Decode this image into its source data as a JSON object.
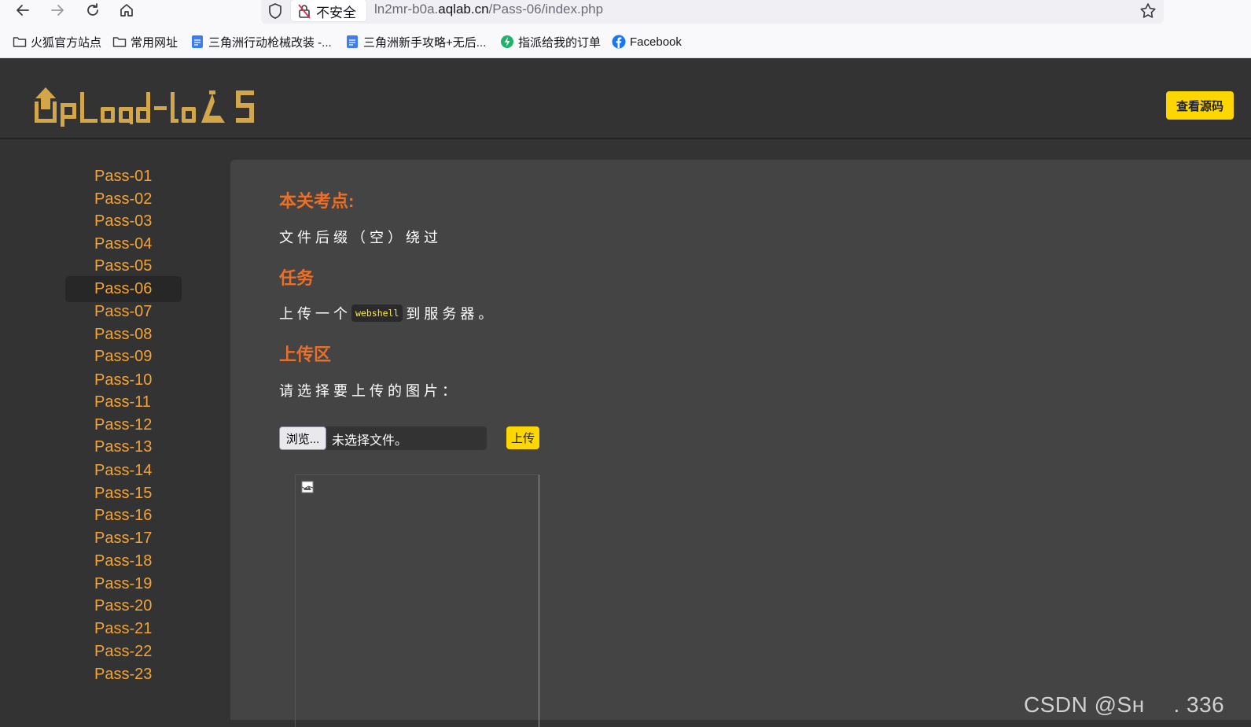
{
  "browser": {
    "security_label": "不安全",
    "url_prefix": "ln2mr-b0a.",
    "url_domain": "aqlab.cn",
    "url_path": "/Pass-06/index.php",
    "icons": [
      "back-arrow-icon",
      "forward-arrow-icon",
      "reload-icon",
      "home-icon",
      "shield-icon",
      "insecure-lock-icon",
      "star-icon"
    ]
  },
  "bookmarks": [
    {
      "label": "火狐官方站点",
      "icon": "folder-icon"
    },
    {
      "label": "常用网址",
      "icon": "folder-icon"
    },
    {
      "label": "三角洲行动枪械改装 -...",
      "icon": "doc-icon"
    },
    {
      "label": "三角洲新手攻略+无后...",
      "icon": "doc-icon"
    },
    {
      "label": "指派给我的订单",
      "icon": "bolt-icon"
    },
    {
      "label": "Facebook",
      "icon": "facebook-icon"
    }
  ],
  "header": {
    "logo_text": "UpLoad-labs",
    "view_source_label": "查看源码"
  },
  "sidebar": {
    "active": "Pass-06",
    "items": [
      "Pass-01",
      "Pass-02",
      "Pass-03",
      "Pass-04",
      "Pass-05",
      "Pass-06",
      "Pass-07",
      "Pass-08",
      "Pass-09",
      "Pass-10",
      "Pass-11",
      "Pass-12",
      "Pass-13",
      "Pass-14",
      "Pass-15",
      "Pass-16",
      "Pass-17",
      "Pass-18",
      "Pass-19",
      "Pass-20",
      "Pass-21",
      "Pass-22",
      "Pass-23"
    ]
  },
  "content": {
    "topic_heading": "本关考点:",
    "topic_text": "文件后缀（空）绕过",
    "task_heading": "任务",
    "task_before": "上传一个",
    "task_code": "webshell",
    "task_after": "到服务器。",
    "upload_heading": "上传区",
    "upload_prompt": "请选择要上传的图片：",
    "browse_label": "浏览...",
    "no_file_label": "未选择文件。",
    "upload_button": "上传"
  },
  "watermark": "CSDN @Sн　 . 336",
  "colors": {
    "page_bg": "#333333",
    "panel_bg": "#444444",
    "accent_yellow": "#ffd700",
    "link_orange": "#f2a33a",
    "heading_orange": "#e9702a",
    "logo_gold": "#d4a64a"
  }
}
